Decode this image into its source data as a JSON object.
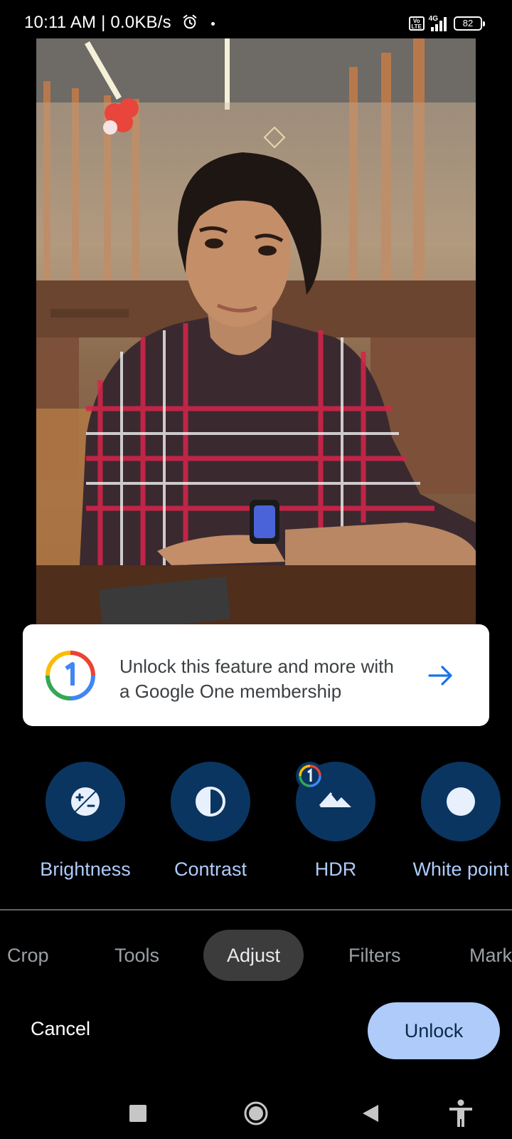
{
  "status_bar": {
    "time": "10:11 AM | 0.0KB/s",
    "network": "4G",
    "volte": "Vo LTE",
    "battery": "82"
  },
  "banner": {
    "line1": "Unlock this feature and more with",
    "line2": "a Google One membership",
    "logo_icon": "google-one-icon",
    "arrow_icon": "arrow-right-icon",
    "arrow_color": "#1a73e8"
  },
  "tools": [
    {
      "label": "Brightness",
      "icon": "brightness-icon"
    },
    {
      "label": "Contrast",
      "icon": "contrast-icon"
    },
    {
      "label": "HDR",
      "icon": "hdr-icon",
      "badge": "google-one-badge-icon"
    },
    {
      "label": "White point",
      "icon": "white-point-icon"
    }
  ],
  "tabs": [
    "Crop",
    "Tools",
    "Adjust",
    "Filters",
    "Mark"
  ],
  "active_tab": "Adjust",
  "actions": {
    "cancel": "Cancel",
    "unlock": "Unlock"
  },
  "colors": {
    "tool_circle": "#0a3560",
    "tool_label": "#aecbfa",
    "unlock_button": "#aecbfa",
    "active_tab_bg": "#3c3c3c"
  }
}
